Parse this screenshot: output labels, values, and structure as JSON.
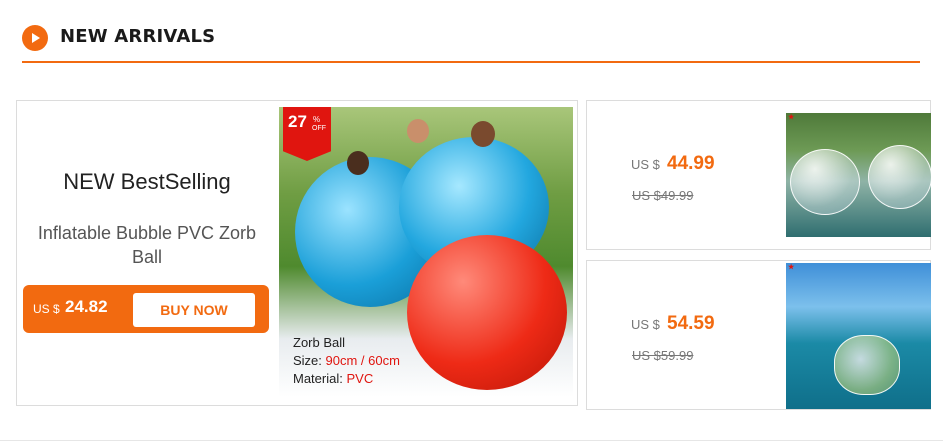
{
  "section": {
    "title": "NEW ARRIVALS"
  },
  "main_card": {
    "heading": "NEW BestSelling",
    "subtitle": "Inflatable Bubble PVC Zorb Ball",
    "price_currency": "US $",
    "price": "24.82",
    "buy_label": "BUY NOW",
    "discount": {
      "value": "27",
      "percent": "%",
      "off": "OFF"
    },
    "image_text": {
      "name": "Zorb Ball",
      "size_label": "Size:",
      "size_value": "90cm / 60cm",
      "material_label": "Material:",
      "material_value": "PVC"
    }
  },
  "side_cards": [
    {
      "currency": "US $",
      "price": "44.99",
      "old_price": "US $49.99"
    },
    {
      "currency": "US $",
      "price": "54.59",
      "old_price": "US $59.99"
    }
  ],
  "colors": {
    "accent": "#f26a10",
    "sale_red": "#e0150f"
  }
}
